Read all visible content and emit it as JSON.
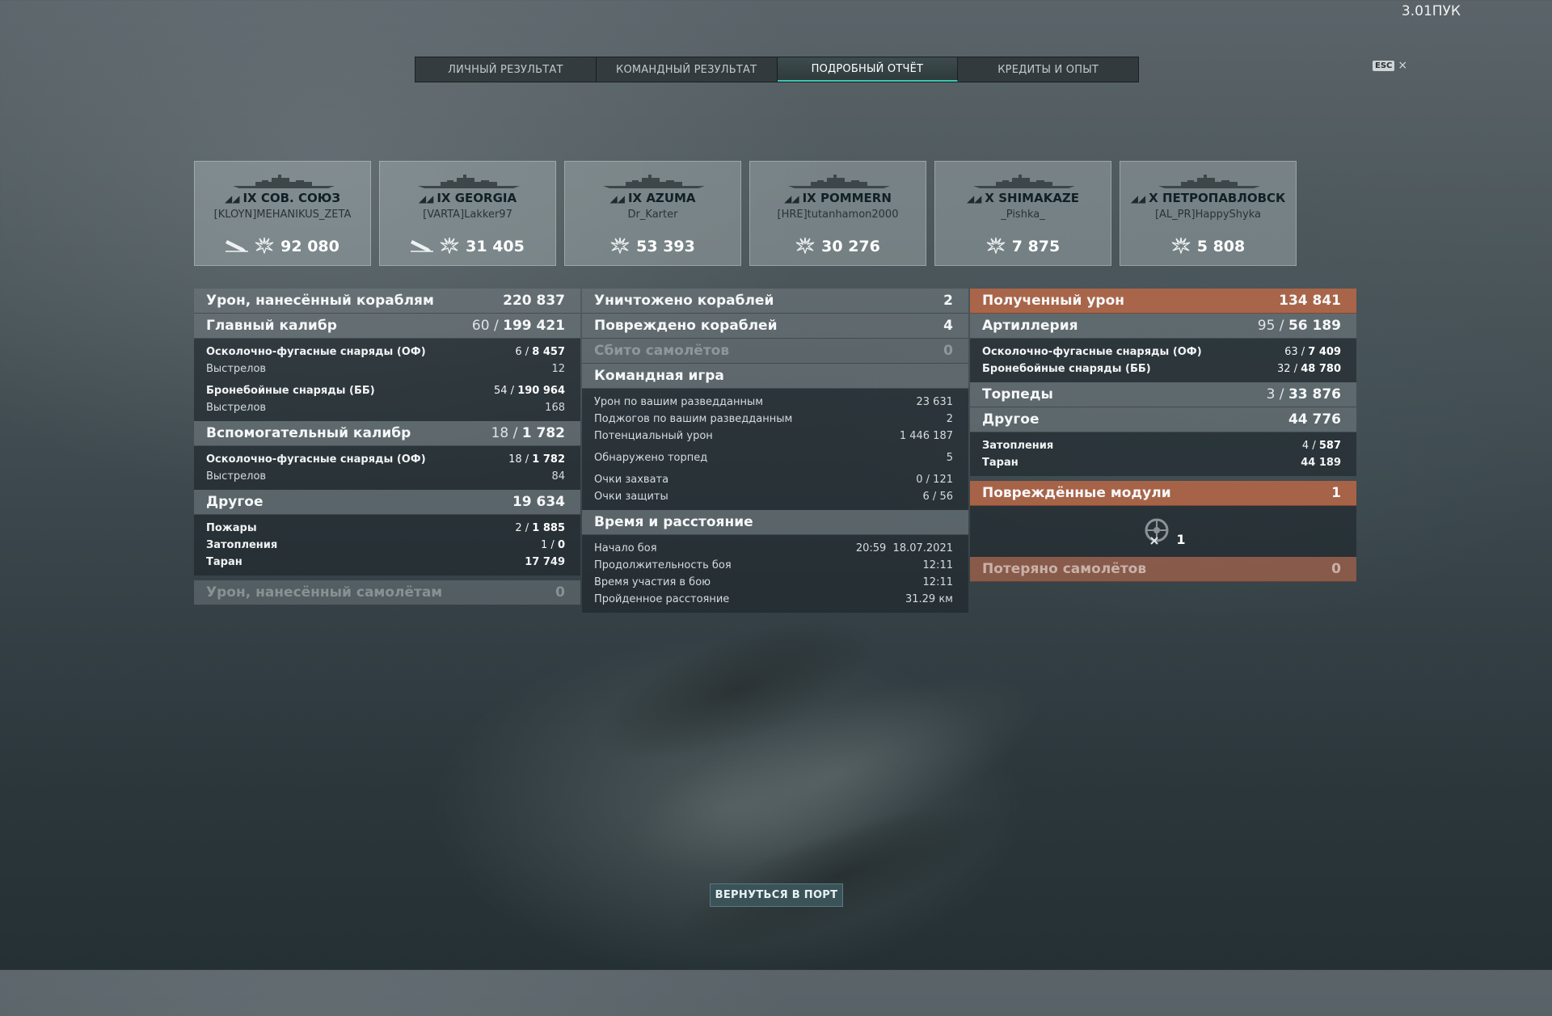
{
  "version": "3.01ПУК",
  "esc": {
    "key": "ESC",
    "close": "×"
  },
  "tabs": [
    {
      "label": "ЛИЧНЫЙ РЕЗУЛЬТАТ",
      "active": false
    },
    {
      "label": "КОМАНДНЫЙ РЕЗУЛЬТАТ",
      "active": false
    },
    {
      "label": "ПОДРОБНЫЙ ОТЧЁТ",
      "active": true
    },
    {
      "label": "КРЕДИТЫ И ОПЫТ",
      "active": false
    }
  ],
  "ships": [
    {
      "tier": "IX",
      "name": "СОВ. СОЮЗ",
      "player": "[KLOYN]MEHANIKUS_ZETA",
      "damage": "92 080",
      "icons": [
        "torpedo-icon",
        "explosion-icon"
      ]
    },
    {
      "tier": "IX",
      "name": "GEORGIA",
      "player": "[VARTA]Lakker97",
      "damage": "31 405",
      "icons": [
        "torpedo-icon",
        "explosion-icon"
      ]
    },
    {
      "tier": "IX",
      "name": "AZUMA",
      "player": "Dr_Karter",
      "damage": "53 393",
      "icons": [
        "explosion-icon"
      ]
    },
    {
      "tier": "IX",
      "name": "POMMERN",
      "player": "[HRE]tutanhamon2000",
      "damage": "30 276",
      "icons": [
        "explosion-icon"
      ]
    },
    {
      "tier": "X",
      "name": "SHIMAKAZE",
      "player": "_Pishka_",
      "damage": "7 875",
      "icons": [
        "explosion-icon"
      ]
    },
    {
      "tier": "X",
      "name": "ПЕТРОПАВЛОВСК",
      "player": "[AL_PR]HappyShyka",
      "damage": "5 808",
      "icons": [
        "explosion-icon"
      ]
    }
  ],
  "left": {
    "damage_ships": {
      "label": "Урон, нанесённый кораблям",
      "value": "220 837"
    },
    "main_battery": {
      "label": "Главный калибр",
      "hits": "60",
      "value": "199 421"
    },
    "main_he": {
      "label": "Осколочно-фугасные снаряды (ОФ)",
      "hits": "6",
      "value": "8 457"
    },
    "main_he_shots": {
      "label": "Выстрелов",
      "value": "12"
    },
    "main_ap": {
      "label": "Бронебойные снаряды (ББ)",
      "hits": "54",
      "value": "190 964"
    },
    "main_ap_shots": {
      "label": "Выстрелов",
      "value": "168"
    },
    "secondary": {
      "label": "Вспомогательный калибр",
      "hits": "18",
      "value": "1 782"
    },
    "sec_he": {
      "label": "Осколочно-фугасные снаряды (ОФ)",
      "hits": "18",
      "value": "1 782"
    },
    "sec_he_shots": {
      "label": "Выстрелов",
      "value": "84"
    },
    "other": {
      "label": "Другое",
      "value": "19 634"
    },
    "fires": {
      "label": "Пожары",
      "hits": "2",
      "value": "1 885"
    },
    "floods": {
      "label": "Затопления",
      "hits": "1",
      "value": "0"
    },
    "ram": {
      "label": "Таран",
      "value": "17 749"
    },
    "damage_planes": {
      "label": "Урон, нанесённый самолётам",
      "value": "0"
    }
  },
  "middle": {
    "destroyed": {
      "label": "Уничтожено кораблей",
      "value": "2"
    },
    "damaged": {
      "label": "Повреждено кораблей",
      "value": "4"
    },
    "planes_shot": {
      "label": "Сбито самолётов",
      "value": "0"
    },
    "teamplay": {
      "label": "Командная игра"
    },
    "spotting_damage": {
      "label": "Урон по вашим разведданным",
      "value": "23 631"
    },
    "spotting_fires": {
      "label": "Поджогов по вашим разведданным",
      "value": "2"
    },
    "potential": {
      "label": "Потенциальный урон",
      "value": "1 446 187"
    },
    "torps_spotted": {
      "label": "Обнаружено торпед",
      "value": "5"
    },
    "capture": {
      "label": "Очки захвата",
      "value": "0 / 121"
    },
    "defense": {
      "label": "Очки защиты",
      "value": "6 / 56"
    },
    "time_distance": {
      "label": "Время и расстояние"
    },
    "start": {
      "label": "Начало боя",
      "value": "20:59  18.07.2021"
    },
    "duration": {
      "label": "Продолжительность боя",
      "value": "12:11"
    },
    "participation": {
      "label": "Время участия в бою",
      "value": "12:11"
    },
    "distance": {
      "label": "Пройденное расстояние",
      "value": "31.29 км"
    }
  },
  "right": {
    "received": {
      "label": "Полученный урон",
      "value": "134 841"
    },
    "artillery": {
      "label": "Артиллерия",
      "hits": "95",
      "value": "56 189"
    },
    "he": {
      "label": "Осколочно-фугасные снаряды (ОФ)",
      "hits": "63",
      "value": "7 409"
    },
    "ap": {
      "label": "Бронебойные снаряды (ББ)",
      "hits": "32",
      "value": "48 780"
    },
    "torpedoes": {
      "label": "Торпеды",
      "hits": "3",
      "value": "33 876"
    },
    "other": {
      "label": "Другое",
      "value": "44 776"
    },
    "floods": {
      "label": "Затопления",
      "hits": "4",
      "value": "587"
    },
    "ram": {
      "label": "Таран",
      "value": "44 189"
    },
    "modules": {
      "label": "Повреждённые модули",
      "value": "1",
      "icon": "steering-module-icon",
      "count": "1"
    },
    "planes_lost": {
      "label": "Потеряно самолётов",
      "value": "0"
    }
  },
  "return_button": "ВЕРНУТЬСЯ В ПОРТ"
}
